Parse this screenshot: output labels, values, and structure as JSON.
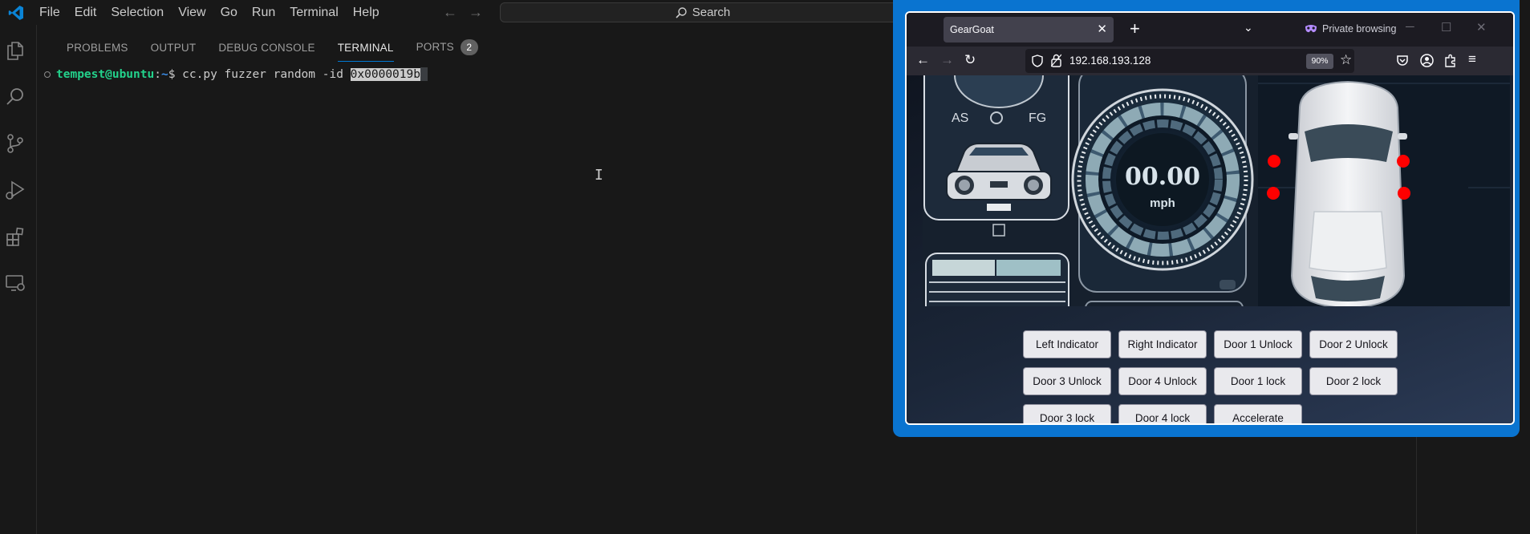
{
  "vscode": {
    "menu": [
      "File",
      "Edit",
      "Selection",
      "View",
      "Go",
      "Run",
      "Terminal",
      "Help"
    ],
    "search_label": "Search",
    "panel_tabs": [
      {
        "label": "PROBLEMS"
      },
      {
        "label": "OUTPUT"
      },
      {
        "label": "DEBUG CONSOLE"
      },
      {
        "label": "TERMINAL"
      },
      {
        "label": "PORTS"
      }
    ],
    "ports_badge": "2",
    "terminal": {
      "user_host": "tempest@ubuntu",
      "colon": ":",
      "path": "~",
      "prompt": "$ ",
      "command": "cc.py fuzzer random -id ",
      "selected": "0x0000019b"
    }
  },
  "browser": {
    "tab_title": "GearGoat",
    "private_label": "Private browsing",
    "url": "192.168.193.128",
    "zoom": "90%",
    "dashboard": {
      "gear_left": "AS",
      "gear_right": "FG",
      "speed": "00.00",
      "unit": "mph"
    },
    "buttons": [
      "Left Indicator",
      "Right Indicator",
      "Door 1 Unlock",
      "Door 2 Unlock",
      "Door 3 Unlock",
      "Door 4 Unlock",
      "Door 1 lock",
      "Door 2 lock",
      "Door 3 lock",
      "Door 4 lock",
      "Accelerate"
    ]
  }
}
